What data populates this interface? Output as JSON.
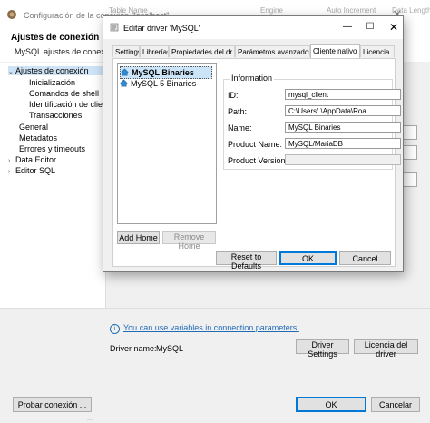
{
  "outer": {
    "window_title": "Configuración de la conexión \"localhost\"",
    "header_title": "Ajustes de conexión",
    "header_subtitle": "MySQL ajustes de conexión",
    "column_headers": [
      "Table Name",
      "Engine",
      "Auto Increment",
      "Data Length"
    ],
    "tree": [
      {
        "label": "Ajustes de conexión",
        "level": 0,
        "expanded": true,
        "selected": true
      },
      {
        "label": "Inicialización",
        "level": 1
      },
      {
        "label": "Comandos de shell",
        "level": 1
      },
      {
        "label": "Identificación de clier",
        "level": 1
      },
      {
        "label": "Transacciones",
        "level": 1
      },
      {
        "label": "General",
        "level": 0
      },
      {
        "label": "Metadatos",
        "level": 0
      },
      {
        "label": "Errores y timeouts",
        "level": 0
      },
      {
        "label": "Data Editor",
        "level": 0,
        "expandable": true
      },
      {
        "label": "Editor SQL",
        "level": 0,
        "expandable": true
      }
    ],
    "variables_link": "You can use variables in connection parameters.",
    "driver_name_label": "Driver name:",
    "driver_name_value": "MySQL",
    "driver_settings_button": "Driver Settings",
    "driver_license_button": "Licencia del driver",
    "test_connection_button": "Probar conexión ...",
    "ok_button": "OK",
    "cancel_button": "Cancelar",
    "footer_fragment": "..."
  },
  "modal": {
    "title": "Editar driver 'MySQL'",
    "tabs": [
      "Settings",
      "Librerías",
      "Propiedades del dr...",
      "Parámetros avanzados",
      "Cliente nativo",
      "Licencia"
    ],
    "active_tab": "Cliente nativo",
    "homes": [
      "MySQL Binaries",
      "MySQL 5 Binaries"
    ],
    "selected_home": "MySQL Binaries",
    "add_home_button": "Add Home",
    "remove_home_button": "Remove Home",
    "info_group_title": "Information",
    "props": [
      {
        "label": "ID:",
        "value": "mysql_client"
      },
      {
        "label": "Path:",
        "value": "C:\\Users\\               \\AppData\\Roa"
      },
      {
        "label": "Name:",
        "value": "MySQL Binaries"
      },
      {
        "label": "Product Name:",
        "value": "MySQL/MariaDB"
      },
      {
        "label": "Product Version:",
        "value": ""
      }
    ],
    "reset_button": "Reset to Defaults",
    "ok_button": "OK",
    "cancel_button": "Cancel"
  },
  "colors": {
    "accent": "#0078d7",
    "link": "#1f6bb5",
    "selection": "#cce4f7"
  }
}
